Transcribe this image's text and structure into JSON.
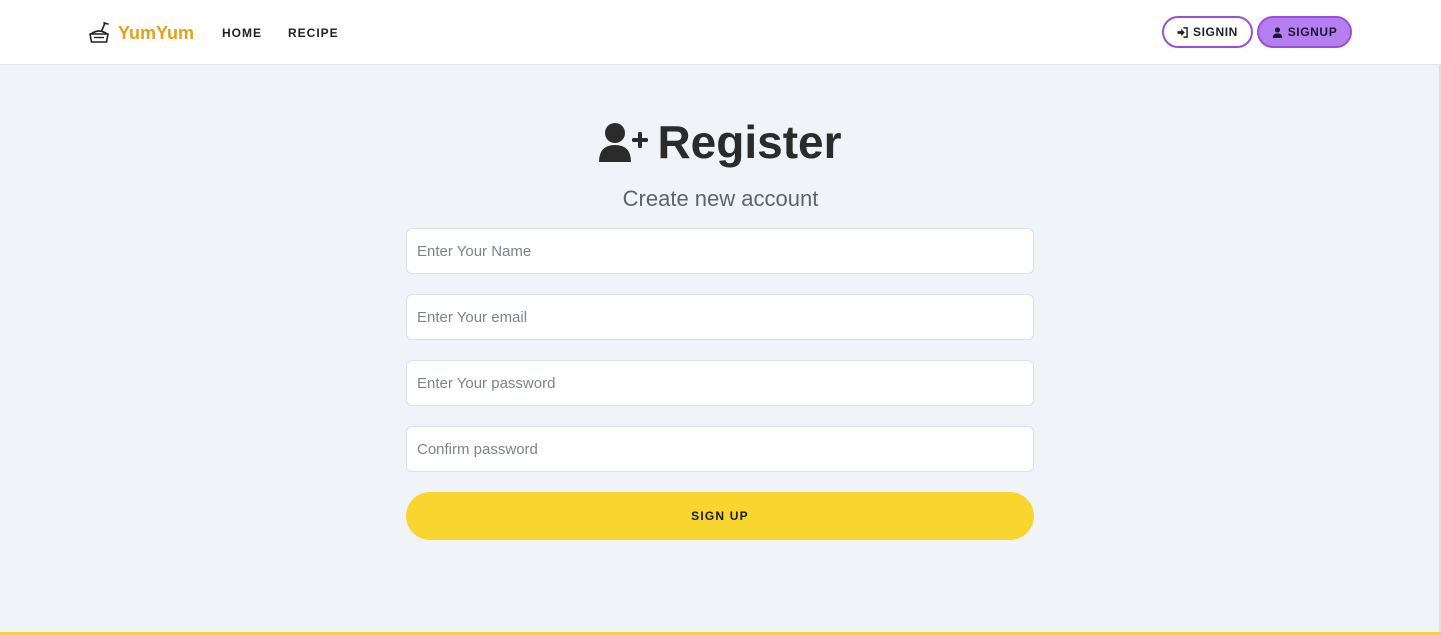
{
  "navbar": {
    "brand": "YumYum",
    "links": [
      "HOME",
      "RECIPE"
    ],
    "signin_label": "SIGNIN",
    "signup_label": "SIGNUP"
  },
  "form": {
    "title": "Register",
    "subtitle": "Create new account",
    "fields": [
      {
        "placeholder": "Enter Your Name",
        "value": ""
      },
      {
        "placeholder": "Enter Your email",
        "value": ""
      },
      {
        "placeholder": "Enter Your password",
        "value": ""
      },
      {
        "placeholder": "Confirm password",
        "value": ""
      }
    ],
    "submit_label": "SIGN UP"
  },
  "icons": {
    "brand": "food-tray-icon",
    "signin": "sign-in-icon",
    "signup": "user-icon",
    "title": "user-plus-icon"
  },
  "colors": {
    "brand": "#e3a018",
    "accent_purple": "#9b4fd8",
    "signup_fill": "#b47ff0",
    "submit_yellow": "#f9d52f",
    "background": "#f0f3f8"
  }
}
